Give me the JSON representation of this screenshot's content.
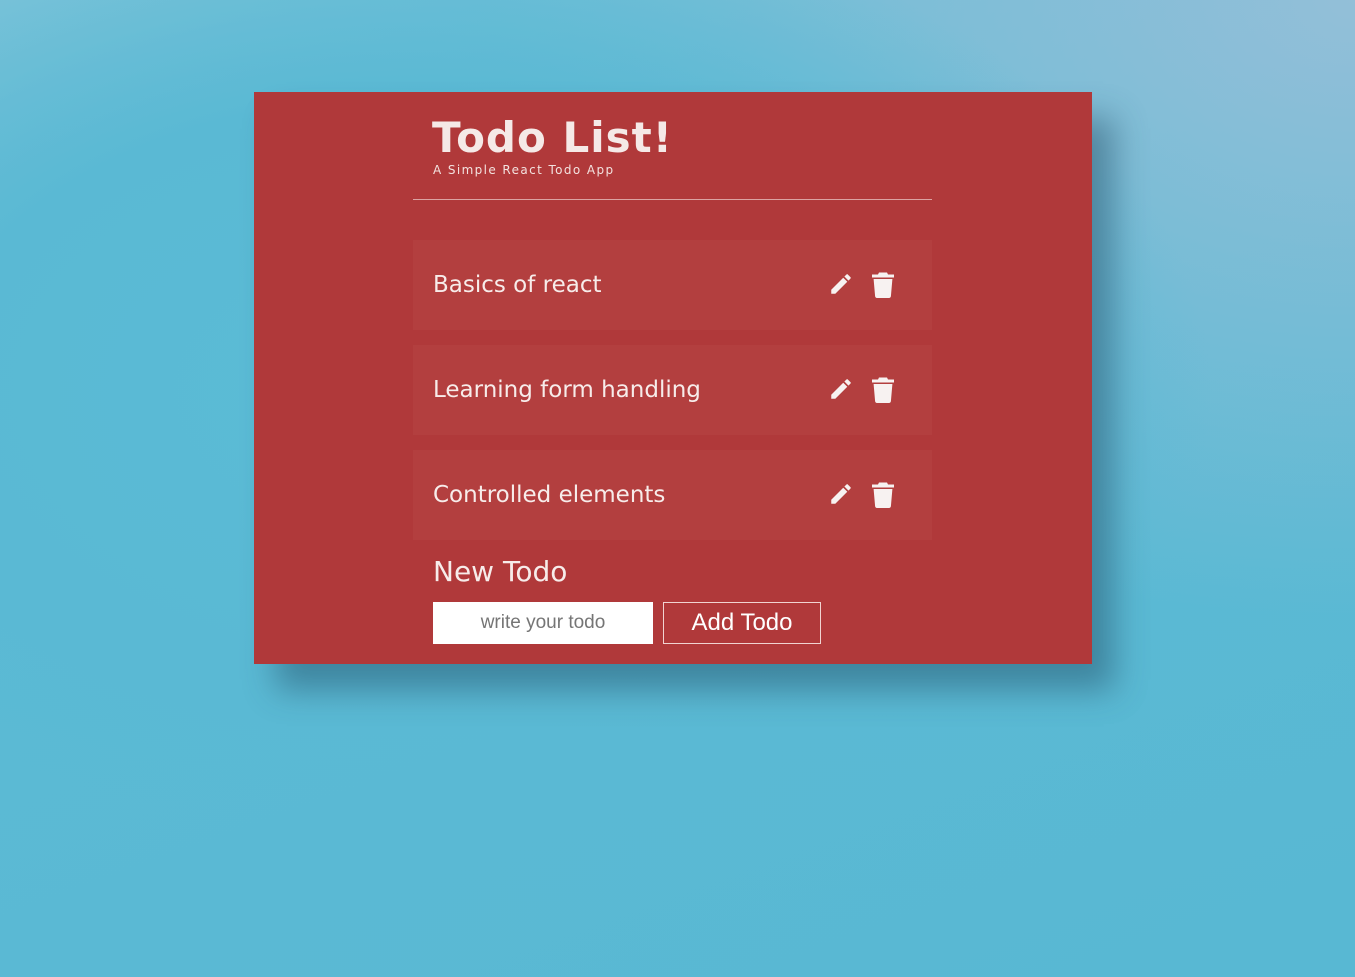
{
  "header": {
    "title": "Todo List!",
    "subtitle": "A Simple React Todo App"
  },
  "todos": [
    {
      "text": "Basics of react",
      "edit_icon": "pencil-icon",
      "delete_icon": "trash-icon"
    },
    {
      "text": "Learning form handling",
      "edit_icon": "pencil-icon",
      "delete_icon": "trash-icon"
    },
    {
      "text": "Controlled elements",
      "edit_icon": "pencil-icon",
      "delete_icon": "trash-icon"
    }
  ],
  "new_todo": {
    "label": "New Todo",
    "input_value": "",
    "placeholder": "write your todo",
    "add_label": "Add Todo"
  },
  "colors": {
    "card_background": "#b0393a",
    "item_background": "#b33f3f",
    "page_background": "#5ab9d4",
    "text": "#f7ecea"
  }
}
